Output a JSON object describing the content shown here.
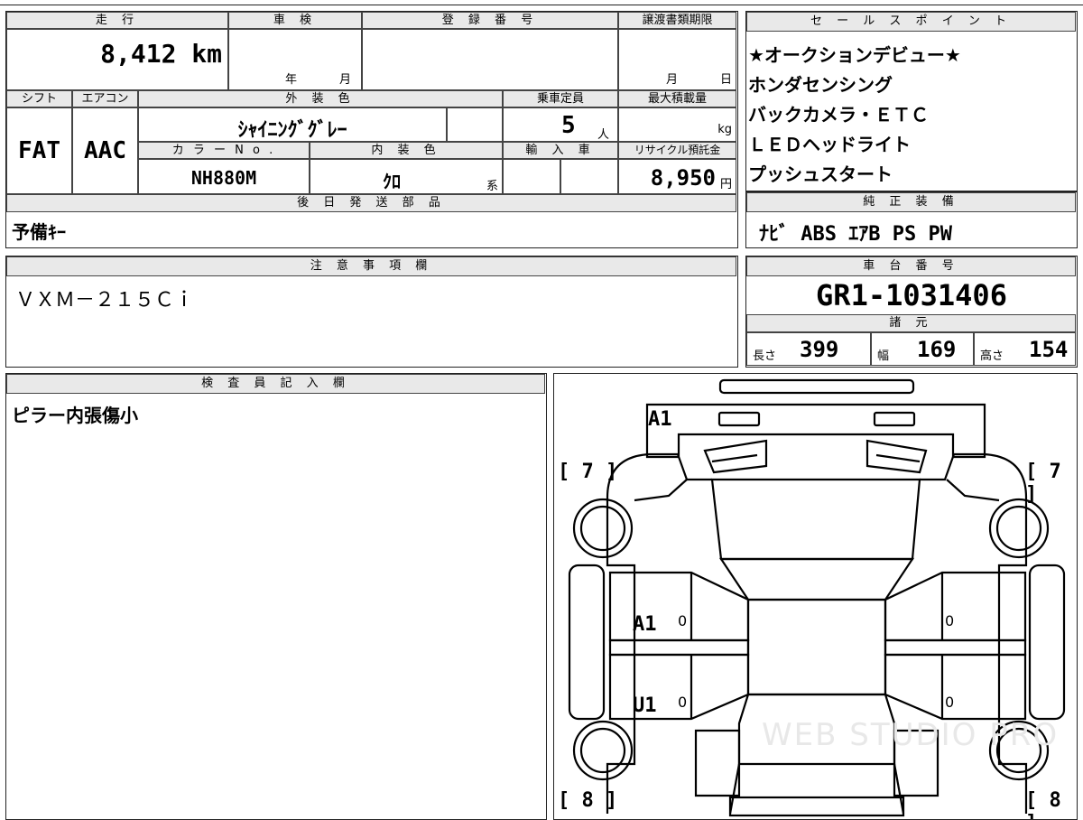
{
  "top_left": {
    "headers": {
      "mileage": "走 行",
      "inspection": "車 検",
      "registration": "登 録 番 号",
      "doc_deadline": "譲渡書類期限",
      "shift": "シフト",
      "aircon": "エアコン",
      "exterior_color": "外 装 色",
      "capacity": "乗車定員",
      "max_load": "最大積載量",
      "color_no": "カ ラ ー N o .",
      "interior_color": "内 装 色",
      "import": "輸 入 車",
      "recycle": "リサイクル預託金",
      "later_parts": "後 日 発 送 部 品"
    },
    "mileage": "8,412 km",
    "inspection_year": "年",
    "inspection_month": "月",
    "deadline_month": "月",
    "deadline_day": "日",
    "shift": "FAT",
    "aircon": "AAC",
    "exterior_color": "ｼｬｲﾆﾝｸﾞｸﾞﾚｰ",
    "capacity": "5",
    "capacity_unit": "人",
    "max_load_unit": "kg",
    "color_no": "NH880M",
    "interior_color": "ｸﾛ",
    "interior_suffix": "系",
    "recycle_amount": "8,950",
    "recycle_unit": "円",
    "later_parts": "予備ｷｰ"
  },
  "sales_points": {
    "header": "セ ー ル ス ポ イ ン ト",
    "items": [
      "★オークションデビュー★",
      "ホンダセンシング",
      "バックカメラ・ＥＴＣ",
      "ＬＥＤヘッドライト",
      "プッシュスタート"
    ]
  },
  "equipment": {
    "header": "純 正 装 備",
    "value": "ﾅﾋﾞ ABS ｴｱB PS PW"
  },
  "notes": {
    "header": "注 意 事 項 欄",
    "value": "ＶＸＭ－２１５Ｃｉ"
  },
  "chassis": {
    "header": "車 台 番 号",
    "value": "GR1-1031406",
    "spec_header": "諸 元",
    "length_label": "長さ",
    "length": "399",
    "width_label": "幅",
    "width": "169",
    "height_label": "高さ",
    "height": "154"
  },
  "inspector": {
    "header": "検 査 員 記 入 欄",
    "value": "ピラー内張傷小"
  },
  "diagram": {
    "front_code": "A1",
    "left_door_code": "A1",
    "left_rear_code": "U1",
    "zero": "0",
    "top_left_bracket": "[ 7 ]",
    "top_right_bracket": "[ 7 ]",
    "bottom_left_bracket": "[ 8 ]",
    "bottom_right_bracket": "[ 8 ]",
    "watermark": "WEB STUDIO PRO"
  }
}
